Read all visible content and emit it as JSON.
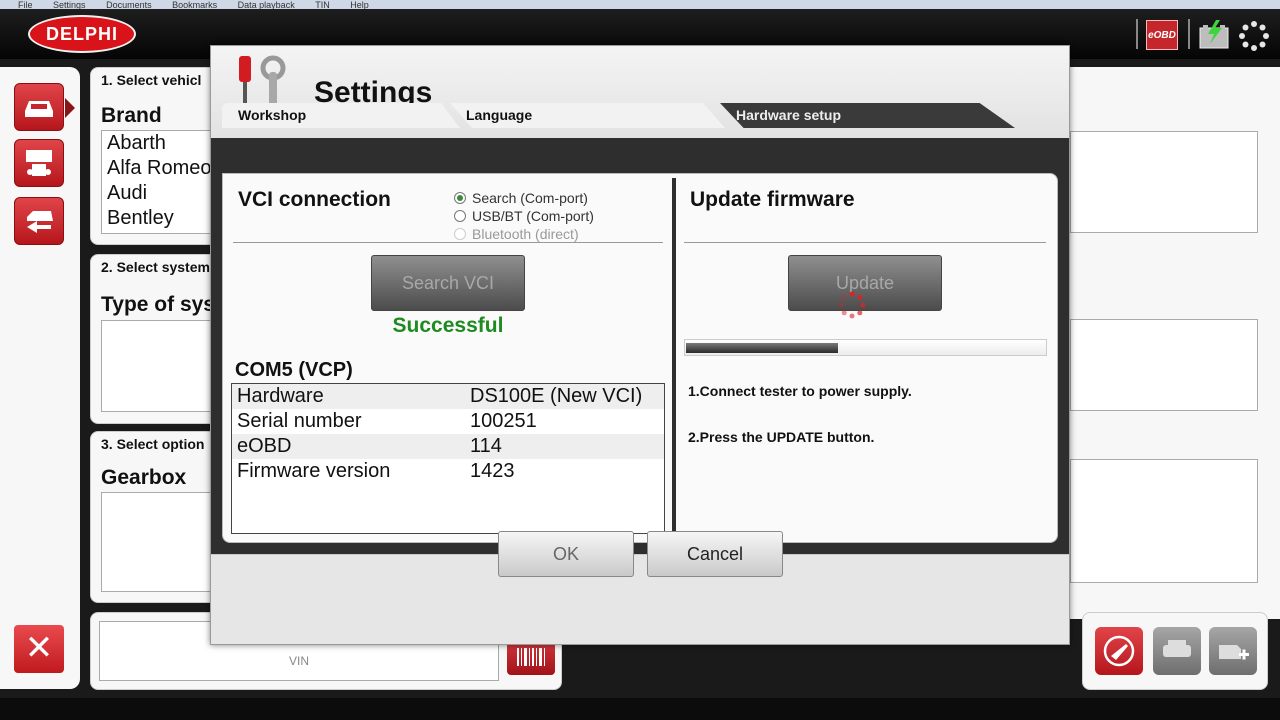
{
  "menubar": {
    "items": [
      "File",
      "Settings",
      "Documents",
      "Bookmarks",
      "Data playback",
      "TIN",
      "Help"
    ]
  },
  "topbar": {
    "logo_text": "DELPHI",
    "eobd_label": "eOBD"
  },
  "vehicle_panel": {
    "title": "1. Select vehicl",
    "brand_label": "Brand",
    "brands": [
      "Abarth",
      "Alfa Romeo",
      "Audi",
      "Bentley"
    ]
  },
  "system_panel": {
    "title": "2. Select system",
    "type_label": "Type of sys"
  },
  "options_panel": {
    "title": "3. Select option",
    "gearbox_label": "Gearbox"
  },
  "vin_panel": {
    "vin_label": "VIN"
  },
  "dialog": {
    "title": "Settings",
    "tabs": [
      {
        "label": "Workshop"
      },
      {
        "label": "Language"
      },
      {
        "label": "Hardware setup"
      }
    ],
    "active_tab": "Hardware setup",
    "vci": {
      "title": "VCI connection",
      "radio_options": [
        {
          "label": "Search (Com-port)",
          "selected": true,
          "enabled": true
        },
        {
          "label": "USB/BT (Com-port)",
          "selected": false,
          "enabled": true
        },
        {
          "label": "Bluetooth (direct)",
          "selected": false,
          "enabled": false
        }
      ],
      "search_button": "Search VCI",
      "status": "Successful",
      "port_caption": "COM5 (VCP)",
      "info": [
        {
          "key": "Hardware",
          "value": "DS100E (New VCI)"
        },
        {
          "key": "Serial number",
          "value": "100251"
        },
        {
          "key": "eOBD",
          "value": "114"
        },
        {
          "key": "Firmware version",
          "value": "1423"
        }
      ]
    },
    "firmware": {
      "title": "Update firmware",
      "update_button": "Update",
      "progress_percent": 42,
      "instructions": [
        "1.Connect tester to power supply.",
        "2.Press the UPDATE button."
      ]
    },
    "ok_button": "OK",
    "cancel_button": "Cancel"
  }
}
